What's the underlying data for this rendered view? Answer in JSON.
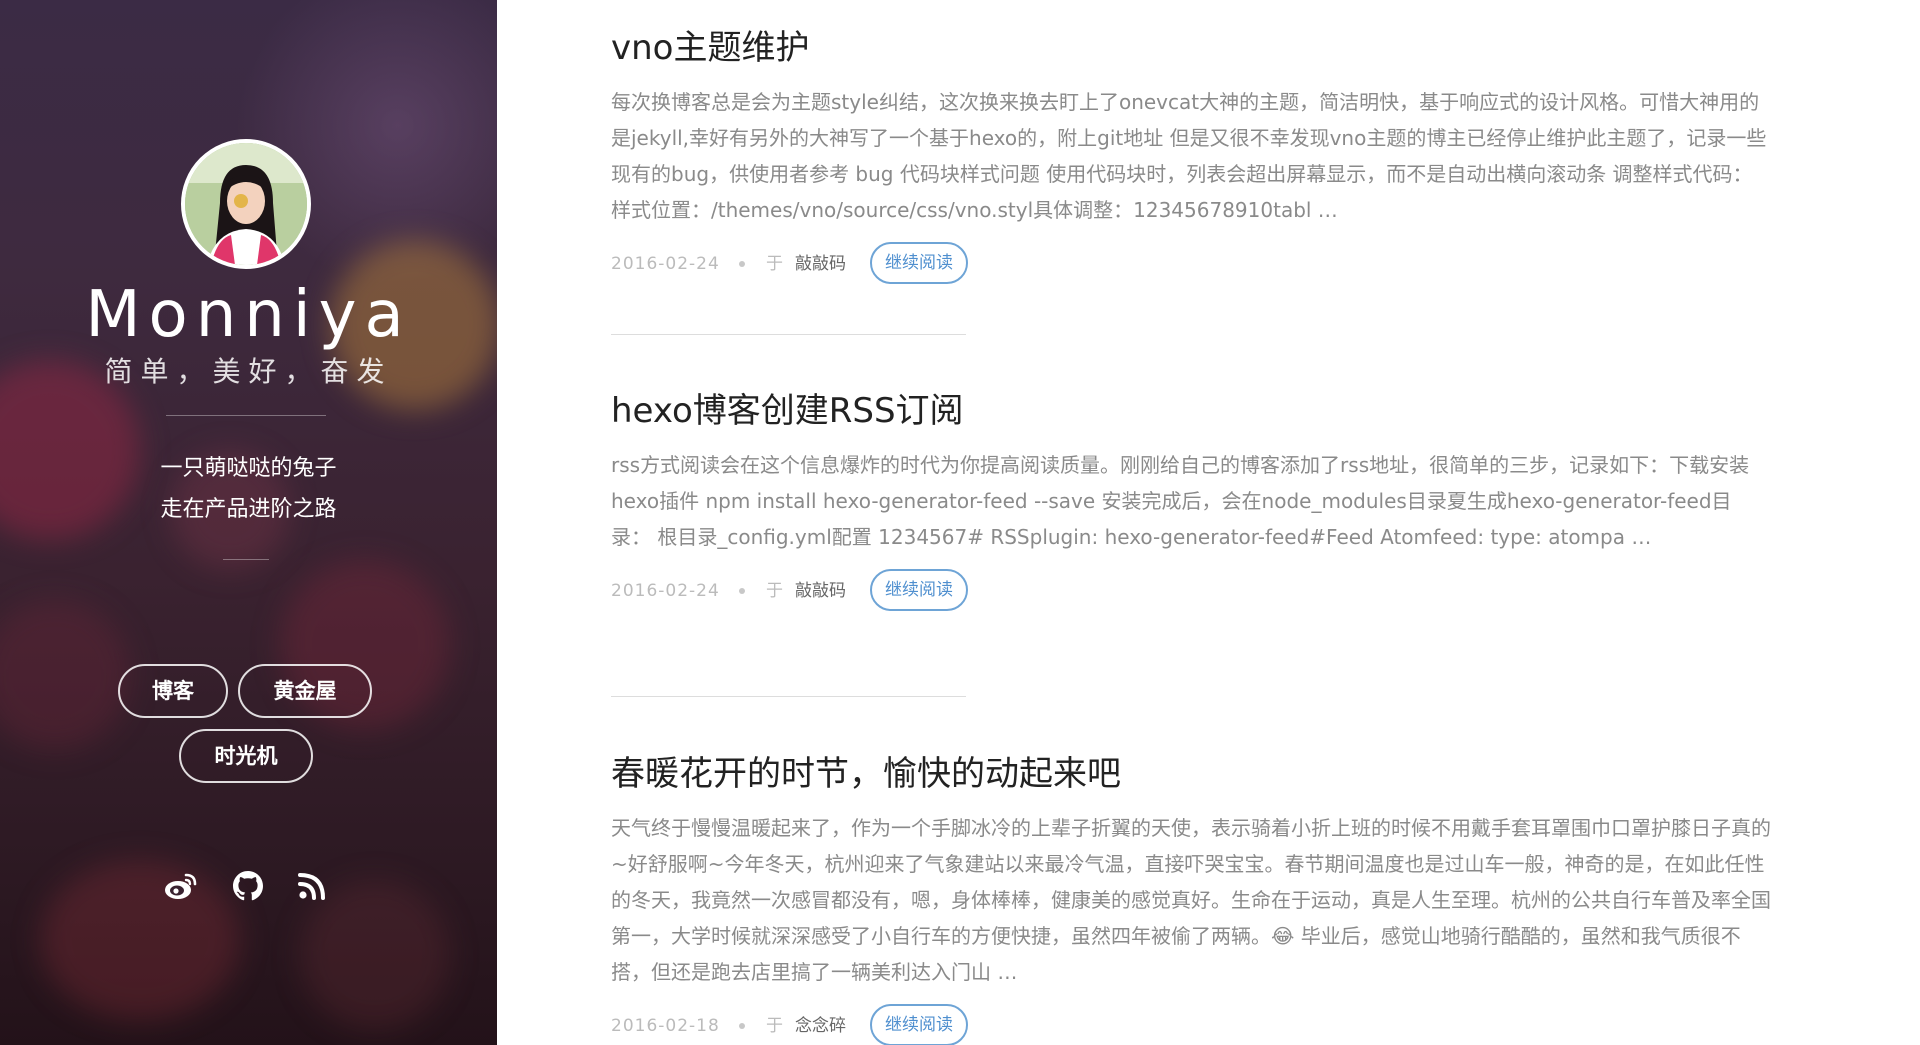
{
  "sidebar": {
    "title": "Monniya",
    "slogan": "简单，美好，奋发",
    "bio": [
      "一只萌哒哒的兔子",
      "走在产品进阶之路"
    ],
    "nav": [
      {
        "label": "博客"
      },
      {
        "label": "黄金屋"
      },
      {
        "label": "时光机"
      }
    ],
    "social": [
      {
        "icon": "weibo-icon"
      },
      {
        "icon": "github-icon"
      },
      {
        "icon": "rss-icon"
      }
    ]
  },
  "posts": [
    {
      "title": "vno主题维护",
      "excerpt": "每次换博客总是会为主题style纠结，这次换来换去盯上了onevcat大神的主题，简洁明快，基于响应式的设计风格。可惜大神用的是jekyll,幸好有另外的大神写了一个基于hexo的，附上git地址 但是又很不幸发现vno主题的博主已经停止维护此主题了，记录一些现有的bug，供使用者参考 bug 代码块样式问题 使用代码块时，列表会超出屏幕显示，而不是自动出横向滚动条 调整样式代码：样式位置：/themes/vno/source/css/vno.styl具体调整：12345678910tabl …",
      "date": "2016-02-24",
      "prefix": "于",
      "tag": "敲敲码",
      "read_more": "继续阅读"
    },
    {
      "title": "hexo博客创建RSS订阅",
      "excerpt": "rss方式阅读会在这个信息爆炸的时代为你提高阅读质量。刚刚给自己的博客添加了rss地址，很简单的三步，记录如下：下载安装hexo插件 npm install hexo-generator-feed --save 安装完成后，会在node_modules目录夏生成hexo-generator-feed目录： 根目录_config.yml配置 1234567# RSSplugin: hexo-generator-feed#Feed Atomfeed: type: atompa …",
      "date": "2016-02-24",
      "prefix": "于",
      "tag": "敲敲码",
      "read_more": "继续阅读"
    },
    {
      "title": "春暖花开的时节，愉快的动起来吧",
      "excerpt": "天气终于慢慢温暖起来了，作为一个手脚冰冷的上辈子折翼的天使，表示骑着小折上班的时候不用戴手套耳罩围巾口罩护膝日子真的~好舒服啊~今年冬天，杭州迎来了气象建站以来最冷气温，直接吓哭宝宝。春节期间温度也是过山车一般，神奇的是，在如此任性的冬天，我竟然一次感冒都没有，嗯，身体棒棒，健康美的感觉真好。生命在于运动，真是人生至理。杭州的公共自行车普及率全国第一，大学时候就深深感受了小自行车的方便快捷，虽然四年被偷了两辆。😂 毕业后，感觉山地骑行酷酷的，虽然和我气质很不搭，但还是跑去店里搞了一辆美利达入门山 …",
      "date": "2016-02-18",
      "prefix": "于",
      "tag": "念念碎",
      "read_more": "继续阅读"
    }
  ],
  "colors": {
    "sidebar_bg": "#3a2230",
    "accent": "#4f8fcf",
    "title_text": "#222222",
    "body_text": "#8a8a8a"
  }
}
